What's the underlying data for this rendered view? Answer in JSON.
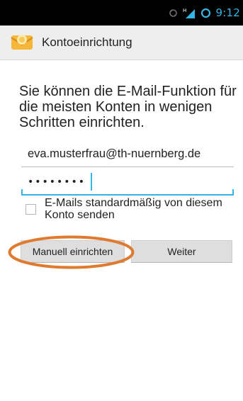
{
  "statusbar": {
    "clock": "9:12",
    "icons": [
      "sync-icon",
      "signal-h-icon",
      "wifi-circle-icon"
    ],
    "network_label": "H",
    "accent_color": "#33b5e5"
  },
  "actionbar": {
    "title": "Kontoeinrichtung",
    "icon": "email-envelope-icon"
  },
  "main": {
    "intro_text": "Sie können die E-Mail-Funktion für die meisten Konten in wenigen Schritten einrichten.",
    "email_value": "eva.musterfrau@th-nuernberg.de",
    "password_mask": "••••••••",
    "checkbox_label": "E-Mails standardmäßig von diesem Konto senden",
    "checkbox_checked": false,
    "manual_button": "Manuell einrichten",
    "next_button": "Weiter",
    "highlight_color": "#e07a2e"
  }
}
